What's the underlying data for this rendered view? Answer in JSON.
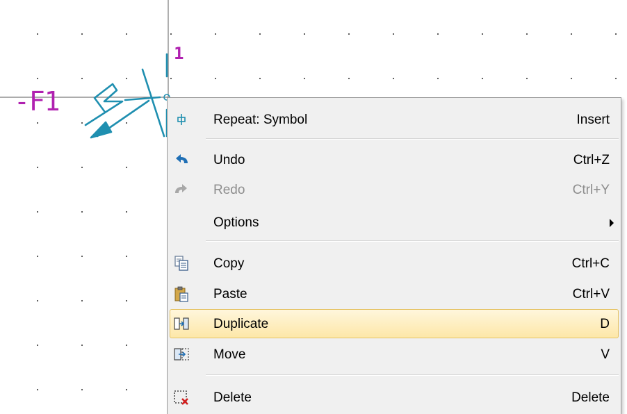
{
  "schematic": {
    "reference": "-F1",
    "pin_number": "1"
  },
  "context_menu": {
    "items": [
      {
        "label": "Repeat: Symbol",
        "shortcut": "Insert",
        "icon": "repeat-symbol-icon"
      },
      {
        "label": "Undo",
        "shortcut": "Ctrl+Z",
        "icon": "undo-icon"
      },
      {
        "label": "Redo",
        "shortcut": "Ctrl+Y",
        "icon": "redo-icon",
        "disabled": true
      },
      {
        "label": "Options",
        "shortcut": "",
        "icon": "",
        "submenu": true
      },
      {
        "label": "Copy",
        "shortcut": "Ctrl+C",
        "icon": "copy-icon"
      },
      {
        "label": "Paste",
        "shortcut": "Ctrl+V",
        "icon": "paste-icon"
      },
      {
        "label": "Duplicate",
        "shortcut": "D",
        "icon": "duplicate-icon",
        "highlighted": true
      },
      {
        "label": "Move",
        "shortcut": "V",
        "icon": "move-icon"
      },
      {
        "label": "Delete",
        "shortcut": "Delete",
        "icon": "delete-icon"
      }
    ]
  },
  "colors": {
    "symbol": "#1f8fb0",
    "reference": "#b021b0",
    "highlight": "#fde7a8",
    "menu_background": "#f0f0f0"
  }
}
